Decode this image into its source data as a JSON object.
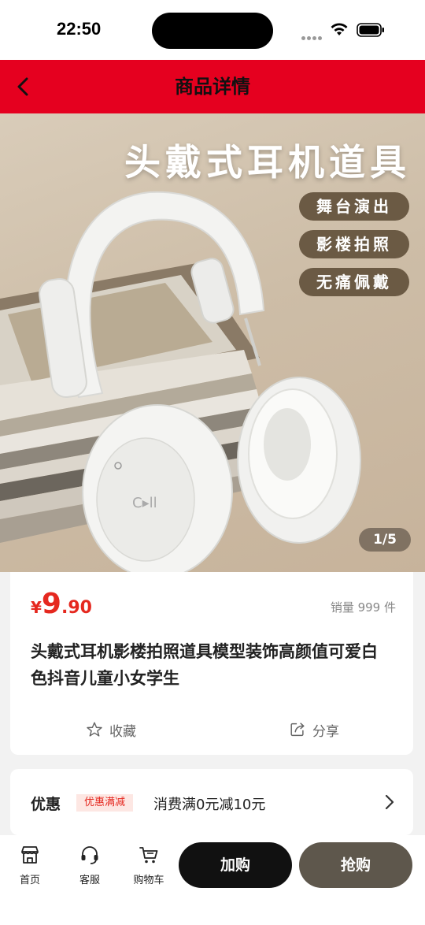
{
  "status_bar": {
    "time": "22:50"
  },
  "nav": {
    "title": "商品详情"
  },
  "hero": {
    "headline": "头戴式耳机道具",
    "tags": [
      "舞台演出",
      "影楼拍照",
      "无痛佩戴"
    ],
    "image_counter": "1/5"
  },
  "product": {
    "price_symbol": "¥",
    "price_integer": "9",
    "price_decimal": ".90",
    "sales": "销量 999 件",
    "name": "头戴式耳机影楼拍照道具模型装饰高颜值可爱白色抖音儿童小女学生",
    "favorite_label": "收藏",
    "share_label": "分享"
  },
  "promo": {
    "label": "优惠",
    "badge": "优惠满减",
    "text": "消费满0元减10元"
  },
  "bottom_bar": {
    "tabs": [
      {
        "label": "首页",
        "icon": "store-icon"
      },
      {
        "label": "客服",
        "icon": "headset-icon"
      },
      {
        "label": "购物车",
        "icon": "cart-icon"
      }
    ],
    "add_to_cart": "加购",
    "buy_now": "抢购"
  },
  "colors": {
    "brand_red": "#e5001f",
    "price_red": "#e5281f",
    "tag_brown": "#6b5a44",
    "buy_button": "#5e574c"
  }
}
